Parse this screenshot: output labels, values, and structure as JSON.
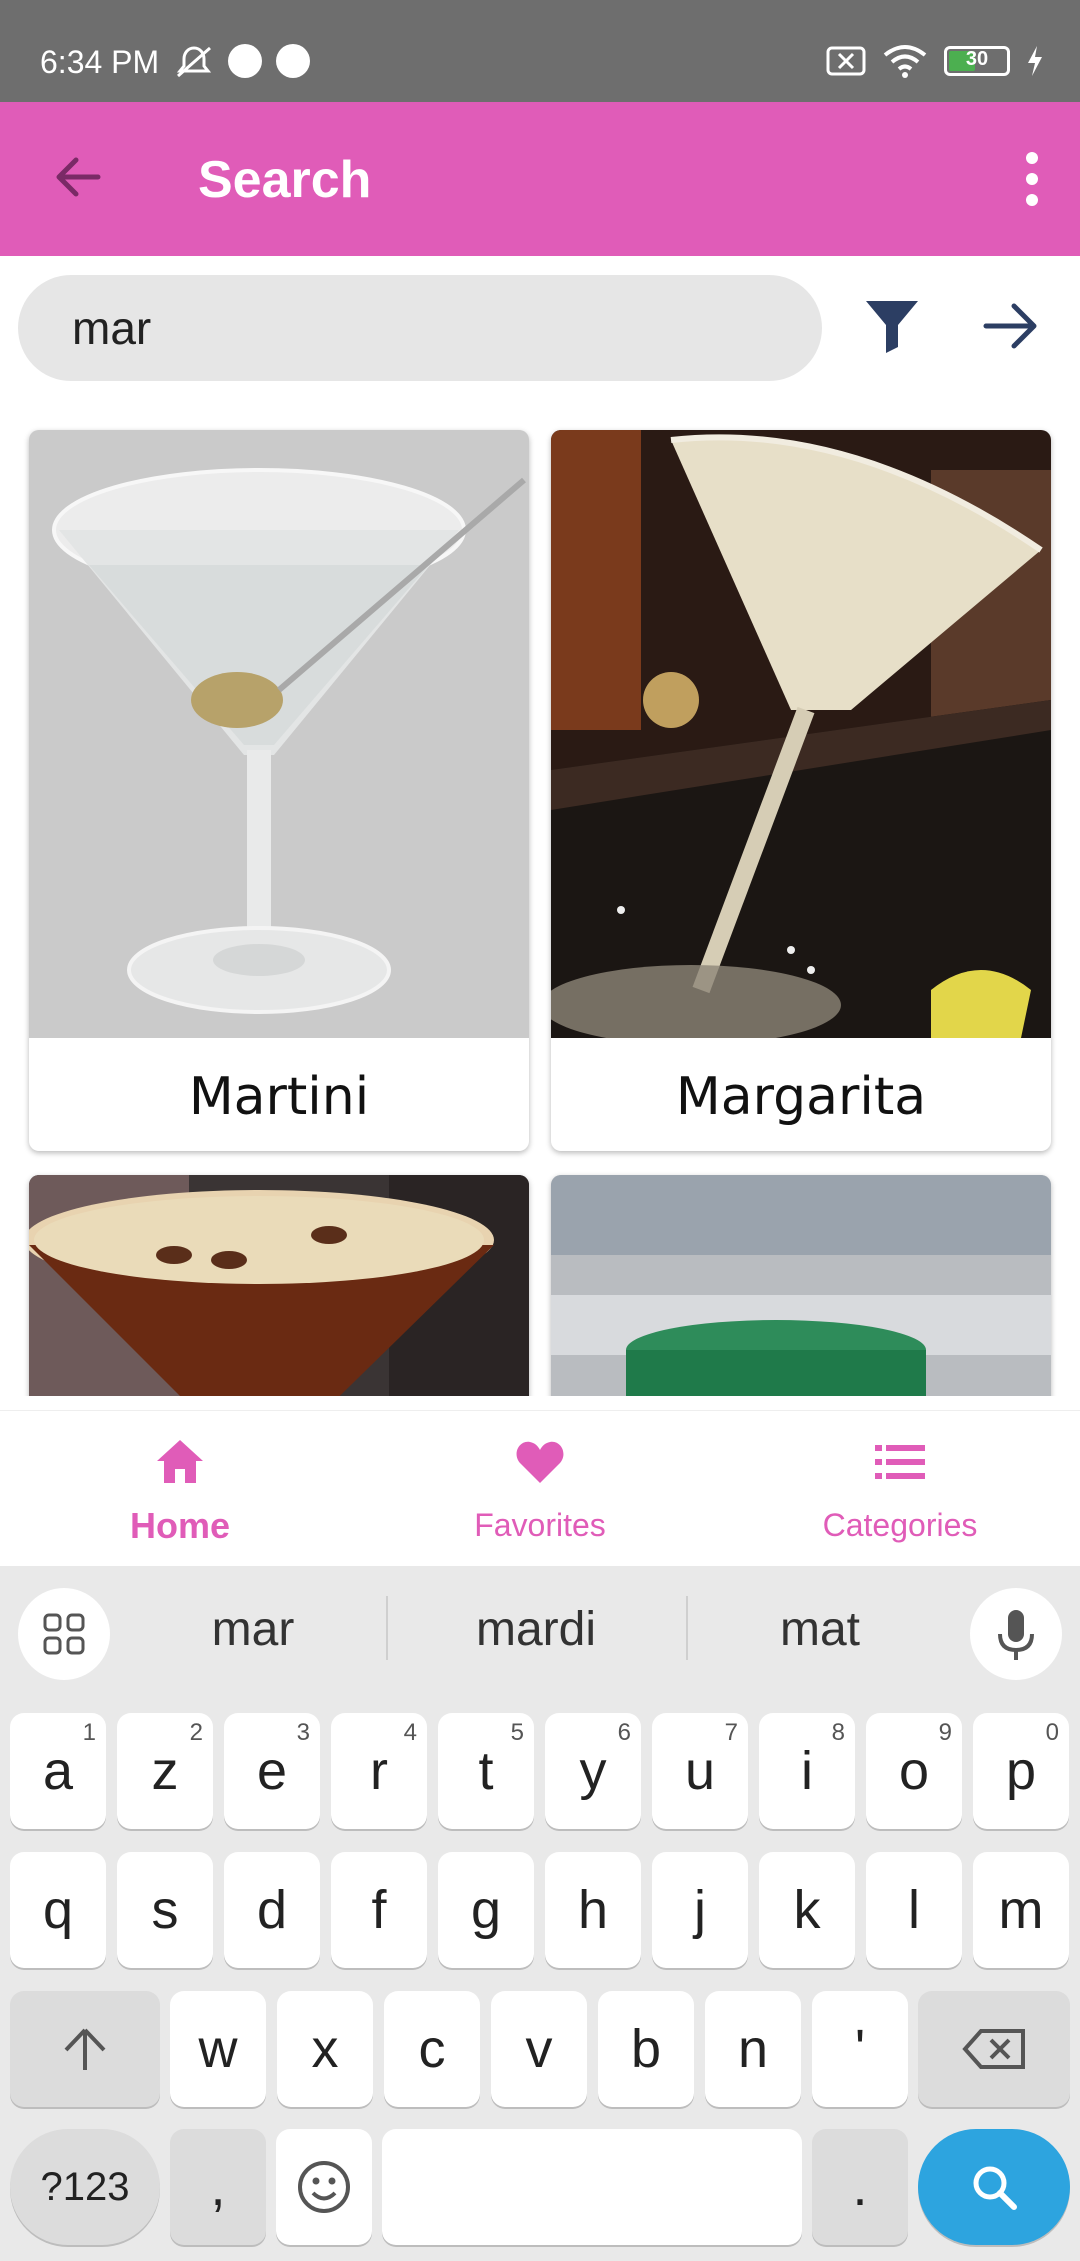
{
  "status_bar": {
    "time": "6:34 PM",
    "battery": "30"
  },
  "app_bar": {
    "title": "Search"
  },
  "search": {
    "value": "mar"
  },
  "results": [
    {
      "name": "Martini"
    },
    {
      "name": "Margarita"
    },
    {
      "name": ""
    },
    {
      "name": ""
    }
  ],
  "bottom_nav": [
    {
      "label": "Home",
      "icon": "home-icon",
      "active": true
    },
    {
      "label": "Favorites",
      "icon": "heart-icon",
      "active": false
    },
    {
      "label": "Categories",
      "icon": "list-icon",
      "active": false
    }
  ],
  "keyboard": {
    "suggestions": [
      "mar",
      "mardi",
      "mat"
    ],
    "row1": [
      "a",
      "z",
      "e",
      "r",
      "t",
      "y",
      "u",
      "i",
      "o",
      "p"
    ],
    "row1_hints": [
      "1",
      "2",
      "3",
      "4",
      "5",
      "6",
      "7",
      "8",
      "9",
      "0"
    ],
    "row2": [
      "q",
      "s",
      "d",
      "f",
      "g",
      "h",
      "j",
      "k",
      "l",
      "m"
    ],
    "row3": [
      "w",
      "x",
      "c",
      "v",
      "b",
      "n",
      "'"
    ],
    "symbols_label": "?123",
    "comma": ",",
    "period": "."
  },
  "colors": {
    "accent": "#e05cb8",
    "search_key": "#2da4df"
  }
}
